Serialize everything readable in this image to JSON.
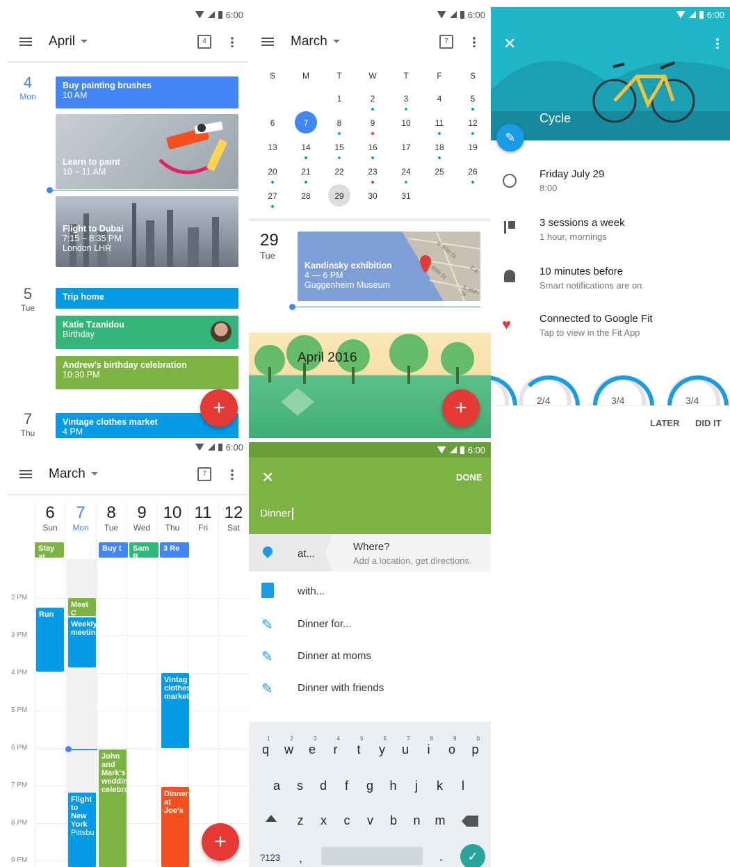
{
  "status": {
    "time": "6:00"
  },
  "p1": {
    "title": "April",
    "cal_day": "4",
    "days": [
      {
        "num": "4",
        "name": "Mon"
      },
      {
        "num": "5",
        "name": "Tue"
      },
      {
        "num": "7",
        "name": "Thu"
      }
    ],
    "events": [
      {
        "title": "Buy painting brushes",
        "time": "10 AM"
      },
      {
        "title": "Learn to paint",
        "time": "10 – 11 AM"
      },
      {
        "title": "Flight to Dubai",
        "time": "7:15 – 8:35 PM",
        "place": "London LHR"
      },
      {
        "title": "Trip home"
      },
      {
        "title": "Katie Tzanidou",
        "time": "Birthday"
      },
      {
        "title": "Andrew's birthday celebration",
        "time": "10:30 PM"
      },
      {
        "title": "Vintage clothes market",
        "time": "4 PM"
      }
    ]
  },
  "p2": {
    "title": "March",
    "cal_day": "7",
    "weekdays": [
      "S",
      "M",
      "T",
      "W",
      "T",
      "F",
      "S"
    ],
    "weeks": [
      [
        "",
        "",
        "1",
        "2",
        "3",
        "4",
        "5"
      ],
      [
        "6",
        "7",
        "8",
        "9",
        "10",
        "11",
        "12"
      ],
      [
        "13",
        "14",
        "15",
        "16",
        "17",
        "18",
        "19"
      ],
      [
        "20",
        "21",
        "22",
        "23",
        "24",
        "25",
        "26"
      ],
      [
        "27",
        "28",
        "29",
        "30",
        "31",
        "",
        ""
      ]
    ],
    "selected_day": "29",
    "selected_dow": "Tue",
    "event": {
      "title": "Kandinsky exhibition",
      "time": "4 — 6 PM",
      "place": "Guggenheim Museum"
    },
    "map_streets": [
      "E 90th St",
      "E 89th St",
      "E 8",
      "E 88th St"
    ],
    "banner": "April 2016"
  },
  "p3": {
    "title": "Cycle",
    "rows": [
      {
        "title": "Friday July 29",
        "sub": "8:00"
      },
      {
        "title": "3 sessions a week",
        "sub": "1 hour, mornings"
      },
      {
        "title": "10 minutes before",
        "sub": "Smart notifications are on"
      },
      {
        "title": "Connected to Google Fit",
        "sub": "Tap to view in the Fit App"
      }
    ],
    "rings": [
      "2/4",
      "3/4",
      "3/4"
    ],
    "later": "LATER",
    "didit": "DID IT"
  },
  "p4": {
    "title": "March",
    "cal_day": "7",
    "cols": [
      {
        "num": "6",
        "name": "Sun"
      },
      {
        "num": "7",
        "name": "Mon"
      },
      {
        "num": "8",
        "name": "Tue"
      },
      {
        "num": "9",
        "name": "Wed"
      },
      {
        "num": "10",
        "name": "Thu"
      },
      {
        "num": "11",
        "name": "Fri"
      },
      {
        "num": "12",
        "name": "Sat"
      }
    ],
    "allday": [
      "Stay at",
      "Buy t",
      "Sam B",
      "3 Re"
    ],
    "hours": [
      "2 PM",
      "3 PM",
      "4 PM",
      "5 PM",
      "6 PM",
      "7 PM",
      "8 PM",
      "9 PM"
    ],
    "events": {
      "run": "Run",
      "meet": "Meet C",
      "weekly": "Weekly meetin",
      "vintage": "Vintag clothes market",
      "john": "John and Mark's weddin celebra",
      "flight": "Flight to New York",
      "flight_sub": "Pittsbu",
      "dinner": "Dinner at Joe's"
    }
  },
  "p5": {
    "done": "DONE",
    "input": "Dinner",
    "suggestion_title": "Where?",
    "suggestion_sub": "Add a location, get directions.",
    "items": [
      "at...",
      "with...",
      "Dinner for...",
      "Dinner at moms",
      "Dinner with friends"
    ],
    "keys_row1": [
      "q",
      "w",
      "e",
      "r",
      "t",
      "y",
      "u",
      "i",
      "o",
      "p"
    ],
    "keys_row1_nums": [
      "1",
      "2",
      "3",
      "4",
      "5",
      "6",
      "7",
      "8",
      "9",
      "0"
    ],
    "keys_row2": [
      "a",
      "s",
      "d",
      "f",
      "g",
      "h",
      "j",
      "k",
      "l"
    ],
    "keys_row3": [
      "z",
      "x",
      "c",
      "v",
      "b",
      "n",
      "m"
    ],
    "sym": "?123",
    "comma": ",",
    "period": "."
  },
  "colors": {
    "blue": "#4285f4",
    "lightblue": "#039be5",
    "green": "#33b679",
    "lime": "#7cb342",
    "red": "#e53935",
    "orange": "#f4511e",
    "teal": "#1fb6c9"
  }
}
